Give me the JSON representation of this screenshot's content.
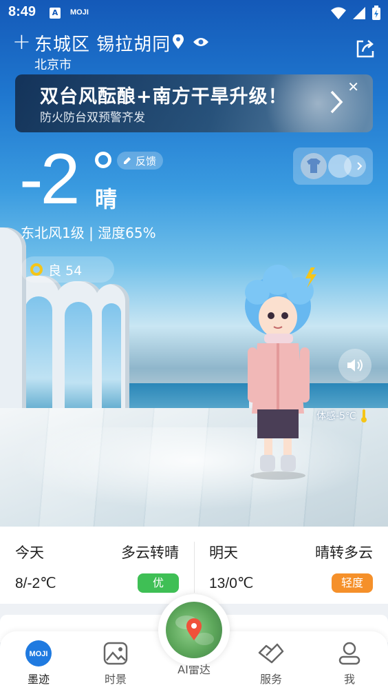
{
  "status_bar": {
    "time": "8:49",
    "app_badge": "A",
    "moji_badge": "MOJI"
  },
  "location": {
    "title": "东城区 锡拉胡同",
    "city": "北京市"
  },
  "banner": {
    "title": "双台风酝酿+南方干旱升级！",
    "subtitle": "防火防台双预警齐发"
  },
  "current": {
    "temperature": "-2",
    "condition": "晴",
    "feedback_label": "反馈",
    "wind_humidity": "东北风1级 | 湿度65%",
    "aqi_label": "良 54",
    "feels_like": "体感-5℃"
  },
  "forecast": {
    "today": {
      "day": "今天",
      "condition": "多云转晴",
      "temp": "8/-2℃",
      "aqi": "优",
      "aqi_color": "#3fbf55"
    },
    "tomorrow": {
      "day": "明天",
      "condition": "晴转多云",
      "temp": "13/0℃",
      "aqi": "轻度",
      "aqi_color": "#f5902a"
    }
  },
  "nav": {
    "items": [
      {
        "label": "墨迹",
        "icon": "moji-logo-icon"
      },
      {
        "label": "时景",
        "icon": "image-icon"
      },
      {
        "label": "AI雷达",
        "icon": "radar-map-icon"
      },
      {
        "label": "服务",
        "icon": "handshake-icon"
      },
      {
        "label": "我",
        "icon": "user-icon"
      }
    ],
    "logo_text": "MOJI"
  },
  "colors": {
    "accent": "#1f7ae0",
    "aqi_good": "#f5c518"
  }
}
